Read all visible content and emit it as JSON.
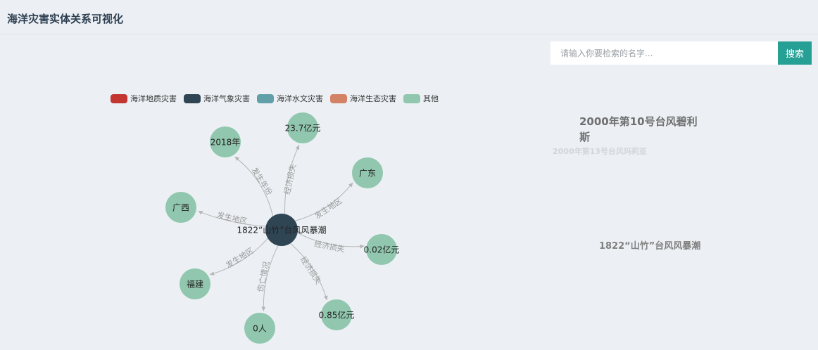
{
  "page": {
    "title": "海洋灾害实体关系可视化"
  },
  "search": {
    "placeholder": "请输入你要检索的名字...",
    "button_label": "搜索"
  },
  "legend": [
    {
      "label": "海洋地质灾害",
      "color": "#c23531"
    },
    {
      "label": "海洋气象灾害",
      "color": "#2f4554"
    },
    {
      "label": "海洋水文灾害",
      "color": "#61a0a8"
    },
    {
      "label": "海洋生态灾害",
      "color": "#d48265"
    },
    {
      "label": "其他",
      "color": "#91c7ae"
    }
  ],
  "graph": {
    "center": {
      "label": "1822“山竹”台风风暴潮",
      "color": "#2f4554"
    },
    "leaf_color": "#91c7ae",
    "nodes": [
      {
        "label": "2018年",
        "relation": "发生年份"
      },
      {
        "label": "23.7亿元",
        "relation": "经济损失"
      },
      {
        "label": "广东",
        "relation": "发生地区"
      },
      {
        "label": "广西",
        "relation": "发生地区"
      },
      {
        "label": "0.02亿元",
        "relation": "经济损失"
      },
      {
        "label": "福建",
        "relation": "发生地区"
      },
      {
        "label": "0人",
        "relation": "伤亡情况"
      },
      {
        "label": "0.85亿元",
        "relation": "经济损失"
      }
    ]
  },
  "side": {
    "title_top": "2000年第10号台风碧利斯",
    "faded": "2000年第13号台风玛莉亚",
    "title_bottom": "1822“山竹”台风风暴潮"
  }
}
